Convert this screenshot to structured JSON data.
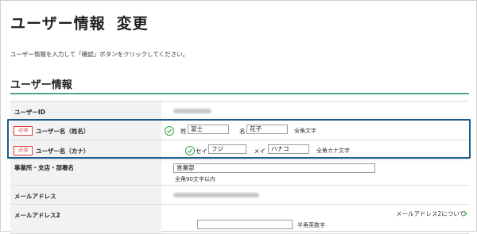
{
  "page": {
    "title_part1": "ユーザー情報",
    "title_part2": "変更",
    "instruction": "ユーザー情報を入力して「確認」ボタンをクリックしてください。"
  },
  "section": {
    "title": "ユーザー情報"
  },
  "form": {
    "user_id": {
      "label": "ユーザーID"
    },
    "name_kanji": {
      "required": "必須",
      "label": "ユーザー名（姓名）",
      "sei_label": "姓",
      "sei_value": "富士",
      "mei_label": "名",
      "mei_value": "花子",
      "hint": "全角文字"
    },
    "name_kana": {
      "required": "必須",
      "label": "ユーザー名（カナ）",
      "sei_label": "セイ",
      "sei_value": "フジ",
      "mei_label": "メイ",
      "mei_value": "ハナコ",
      "hint": "全角カナ文字"
    },
    "office": {
      "label": "事業所・支店・部署名",
      "value": "営業部",
      "hint": "全角90文字以内"
    },
    "mail": {
      "label": "メールアドレス"
    },
    "mail2": {
      "label": "メールアドレス2",
      "link": "メールアドレス2について",
      "hint": "半角英数字",
      "value": ""
    }
  },
  "colors": {
    "accent_rule": "#4aa88b",
    "required_red": "#d94040",
    "check_green": "#3aa04a",
    "highlight_blue": "#1b5a8a"
  }
}
